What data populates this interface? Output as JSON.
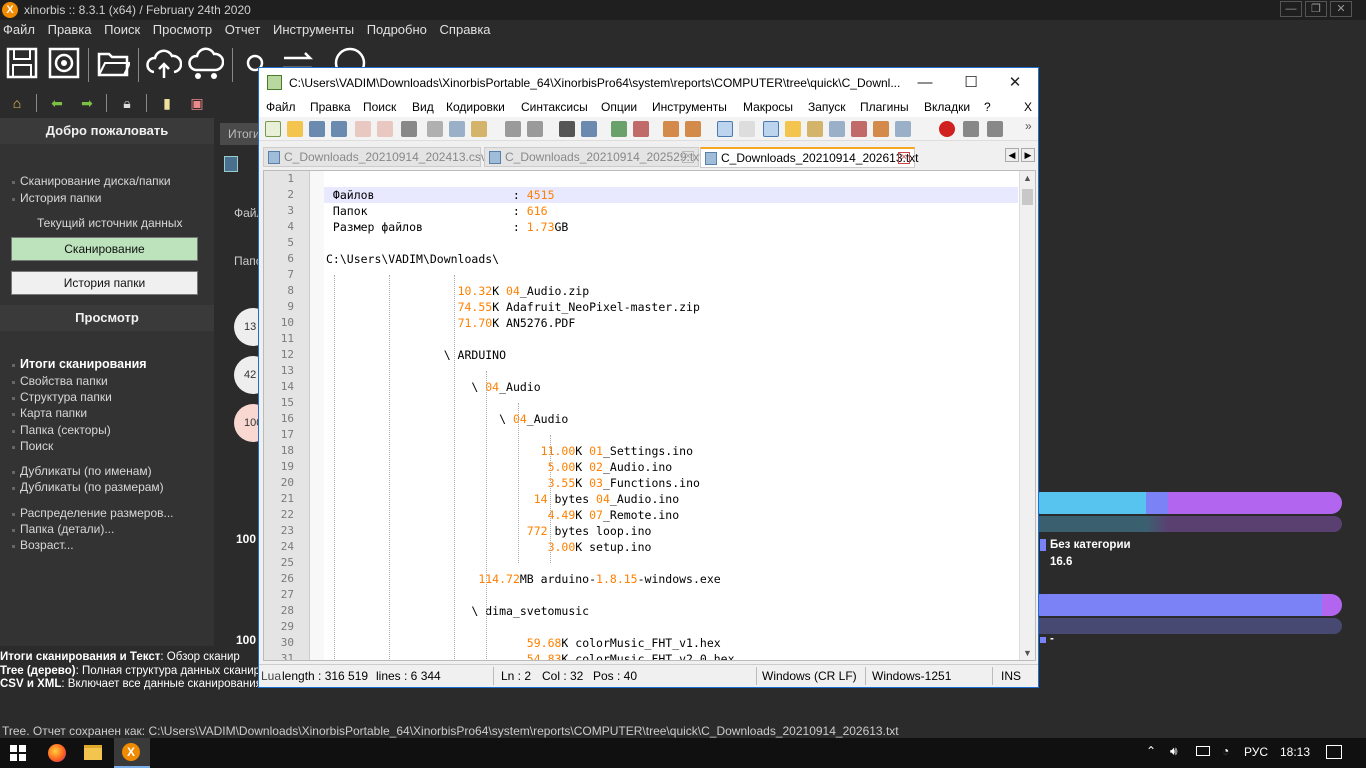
{
  "app": {
    "title": "xinorbis :: 8.3.1 (x64) / February 24th 2020",
    "menu": [
      "Файл",
      "Правка",
      "Поиск",
      "Просмотр",
      "Отчет",
      "Инструменты",
      "Подробно",
      "Справка"
    ]
  },
  "left_panel": {
    "welcome_header": "Добро пожаловать",
    "welcome_items": [
      "Сканирование диска/папки",
      "История папки"
    ],
    "current_source_label": "Текущий источник данных",
    "scan_button": "Сканирование",
    "history_button": "История папки",
    "view_header": "Просмотр",
    "view_items_bold": "Итоги сканирования",
    "view_items": [
      "Свойства папки",
      "Структура папки",
      "Карта папки",
      "Папка (секторы)",
      "Поиск",
      "Дубликаты (по именам)",
      "Дубликаты (по размерам)",
      "Распределение размеров...",
      "Папка (детали)...",
      "Возраст..."
    ]
  },
  "middle": {
    "tab_partial": "Итоги",
    "label_files_partial": "Файл",
    "label_folders_partial": "Папо",
    "circles": [
      "13",
      "42",
      "100"
    ],
    "pct_left_1": "100",
    "pct_left_2": "100",
    "legend_label": "Без категории",
    "legend_value": "16.6",
    "legend_dash": "-",
    "colors": {
      "blue": "#57c3ef",
      "purple": "#b266f0",
      "indigo": "#7a82f5"
    }
  },
  "bottom_info": {
    "line1_bold": "Итоги сканирования и Текст",
    "line1": ": Обзор сканир",
    "line2_bold": "Tree (дерево)",
    "line2": ": Полная структура данных сканир",
    "line3_bold": "CSV и XML",
    "line3": ": Включает все данные сканирования"
  },
  "status_line": "Tree. Отчет сохранен как: C:\\Users\\VADIM\\Downloads\\XinorbisPortable_64\\XinorbisPro64\\system\\reports\\COMPUTER\\tree\\quick\\C_Downloads_20210914_202613.txt",
  "taskbar": {
    "lang": "РУС",
    "time": "18:13"
  },
  "npp": {
    "title": "C:\\Users\\VADIM\\Downloads\\XinorbisPortable_64\\XinorbisPro64\\system\\reports\\COMPUTER\\tree\\quick\\C_Downl...",
    "menu": [
      "Файл",
      "Правка",
      "Поиск",
      "Вид",
      "Кодировки",
      "Синтаксисы",
      "Опции",
      "Инструменты",
      "Макросы",
      "Запуск",
      "Плагины",
      "Вкладки",
      "?",
      "X"
    ],
    "tabs": [
      "C_Downloads_20210914_202413.csv",
      "C_Downloads_20210914_202529.txt",
      "C_Downloads_20210914_202613.txt"
    ],
    "status": {
      "length": "length : 316 519",
      "lines": "lines : 6 344",
      "ln": "Ln : 2",
      "col": "Col : 32",
      "pos": "Pos : 40",
      "eol": "Windows (CR LF)",
      "encoding": "Windows-1251",
      "mode": "INS",
      "prefix": "Lua"
    },
    "lines": [
      {
        "n": "1",
        "t": ""
      },
      {
        "n": "2",
        "t": " Файлов                    : ",
        "num": "4515"
      },
      {
        "n": "3",
        "t": " Папок                     : ",
        "num": "616"
      },
      {
        "n": "4",
        "t": " Размер файлов             : ",
        "num": "1.73",
        "tail": "GB"
      },
      {
        "n": "5",
        "t": ""
      },
      {
        "n": "6",
        "t": "C:\\Users\\VADIM\\Downloads\\"
      },
      {
        "n": "7",
        "t": ""
      },
      {
        "n": "8",
        "t": "                   ",
        "num": "10.32",
        "tail": "K ",
        "num2": "04",
        "tail2": "_Audio.zip"
      },
      {
        "n": "9",
        "t": "                   ",
        "num": "74.55",
        "tail": "K Adafruit_NeoPixel-master.zip"
      },
      {
        "n": "10",
        "t": "                   ",
        "num": "71.70",
        "tail": "K AN5276.PDF"
      },
      {
        "n": "11",
        "t": ""
      },
      {
        "n": "12",
        "t": "                 \\ ARDUINO"
      },
      {
        "n": "13",
        "t": ""
      },
      {
        "n": "14",
        "t": "                     \\ ",
        "num": "04",
        "tail": "_Audio"
      },
      {
        "n": "15",
        "t": ""
      },
      {
        "n": "16",
        "t": "                         \\ ",
        "num": "04",
        "tail": "_Audio"
      },
      {
        "n": "17",
        "t": ""
      },
      {
        "n": "18",
        "t": "                               ",
        "num": "11.00",
        "tail": "K ",
        "num2": "01",
        "tail2": "_Settings.ino"
      },
      {
        "n": "19",
        "t": "                                ",
        "num": "5.00",
        "tail": "K ",
        "num2": "02",
        "tail2": "_Audio.ino"
      },
      {
        "n": "20",
        "t": "                                ",
        "num": "3.55",
        "tail": "K ",
        "num2": "03",
        "tail2": "_Functions.ino"
      },
      {
        "n": "21",
        "t": "                              ",
        "num": "14",
        "tail": " bytes ",
        "num2": "04",
        "tail2": "_Audio.ino"
      },
      {
        "n": "22",
        "t": "                                ",
        "num": "4.49",
        "tail": "K ",
        "num2": "07",
        "tail2": "_Remote.ino"
      },
      {
        "n": "23",
        "t": "                             ",
        "num": "772",
        "tail": " bytes loop.ino"
      },
      {
        "n": "24",
        "t": "                                ",
        "num": "3.00",
        "tail": "K setup.ino"
      },
      {
        "n": "25",
        "t": ""
      },
      {
        "n": "26",
        "t": "                      ",
        "num": "114.72",
        "tail": "MB arduino-",
        "num2": "1.8.15",
        "tail2": "-windows.exe"
      },
      {
        "n": "27",
        "t": ""
      },
      {
        "n": "28",
        "t": "                     \\ dima_svetomusic"
      },
      {
        "n": "29",
        "t": ""
      },
      {
        "n": "30",
        "t": "                             ",
        "num": "59.68",
        "tail": "K colorMusic_FHT_v1.hex"
      },
      {
        "n": "31",
        "t": "                             ",
        "num": "54.83",
        "tail": "K colorMusic_FHT_v2.0.hex"
      }
    ]
  }
}
